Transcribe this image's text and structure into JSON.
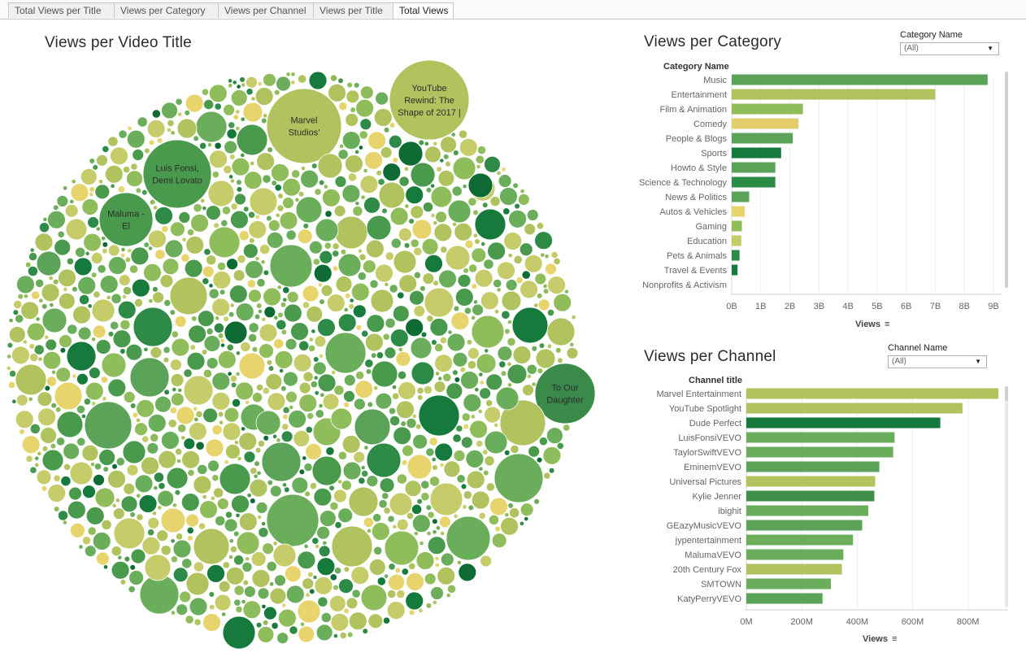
{
  "tabs": [
    {
      "label": "Total Views per Title",
      "active": false
    },
    {
      "label": "Views per Category",
      "active": false
    },
    {
      "label": "Views per Channel",
      "active": false
    },
    {
      "label": "Views per Title",
      "active": false
    },
    {
      "label": "Total Views",
      "active": true
    }
  ],
  "bubble_panel": {
    "title": "Views per Video Title",
    "labeled_bubbles": [
      {
        "label": "YouTube Rewind: The Shape of 2017 |",
        "lines": [
          "YouTube",
          "Rewind: The",
          "Shape of 2017 |"
        ],
        "color": "#b0c35f"
      },
      {
        "label": "Marvel Studios'",
        "lines": [
          "Marvel",
          "Studios'"
        ],
        "color": "#b0c35f"
      },
      {
        "label": "Luis Fonsi, Demi Lovato",
        "lines": [
          "Luis Fonsi,",
          "Demi Lovato"
        ],
        "color": "#4a9a4e"
      },
      {
        "label": "Maluma - El",
        "lines": [
          "Maluma -",
          "El"
        ],
        "color": "#4a9a4e"
      },
      {
        "label": "To Our Daughter",
        "lines": [
          "To Our",
          "Daughter"
        ],
        "color": "#3a8a4a"
      }
    ],
    "palette": [
      "#b0c35f",
      "#c6cc6a",
      "#e8d46c",
      "#8fbd5c",
      "#6aad5a",
      "#4a9a4e",
      "#2e8a47",
      "#157a3c",
      "#0e6b34"
    ]
  },
  "category_panel": {
    "title": "Views per Category",
    "filter": {
      "label": "Category Name",
      "value": "(All)"
    },
    "column_header": "Category Name",
    "axis_title": "Views"
  },
  "channel_panel": {
    "title": "Views per Channel",
    "filter": {
      "label": "Channel Name",
      "value": "(All)"
    },
    "column_header": "Channel title",
    "axis_title": "Views"
  },
  "chart_data": [
    {
      "type": "bar",
      "orientation": "horizontal",
      "title": "Views per Category",
      "ylabel": "Category Name",
      "xlabel": "Views",
      "categories": [
        "Music",
        "Entertainment",
        "Film & Animation",
        "Comedy",
        "People & Blogs",
        "Sports",
        "Howto & Style",
        "Science & Technology",
        "News & Politics",
        "Autos & Vehicles",
        "Gaming",
        "Education",
        "Pets & Animals",
        "Travel & Events",
        "Nonprofits & Activism"
      ],
      "values": [
        8.8,
        7.0,
        2.45,
        2.3,
        2.1,
        1.7,
        1.5,
        1.5,
        0.6,
        0.45,
        0.35,
        0.33,
        0.27,
        0.2,
        0.0
      ],
      "value_unit": "B",
      "colors": [
        "#5ba359",
        "#b0c35f",
        "#8fbd5c",
        "#e3cd6a",
        "#5ba359",
        "#157a3c",
        "#5ba359",
        "#2e8a47",
        "#5ba359",
        "#e8d46c",
        "#8fbd5c",
        "#c6cc6a",
        "#2e8a47",
        "#157a3c",
        "#5ba359"
      ],
      "xticks": [
        "0B",
        "1B",
        "2B",
        "3B",
        "4B",
        "5B",
        "6B",
        "7B",
        "8B",
        "9B"
      ],
      "xlim": [
        0,
        9
      ],
      "grid": true
    },
    {
      "type": "bar",
      "orientation": "horizontal",
      "title": "Views per Channel",
      "ylabel": "Channel title",
      "xlabel": "Views",
      "categories": [
        "Marvel Entertainment",
        "YouTube Spotlight",
        "Dude Perfect",
        "LuisFonsiVEVO",
        "TaylorSwiftVEVO",
        "EminemVEVO",
        "Universal Pictures",
        "Kylie Jenner",
        "ibighit",
        "GEazyMusicVEVO",
        "jypentertainment",
        "MalumaVEVO",
        "20th Century Fox",
        "SMTOWN",
        "KatyPerryVEVO"
      ],
      "values": [
        910,
        780,
        700,
        535,
        530,
        480,
        465,
        462,
        440,
        418,
        385,
        350,
        345,
        305,
        275
      ],
      "value_unit": "M",
      "colors": [
        "#b0c35f",
        "#b0c35f",
        "#157a3c",
        "#6aad5a",
        "#6aad5a",
        "#5ba359",
        "#b0c35f",
        "#3f8f4a",
        "#6aad5a",
        "#5ba359",
        "#6aad5a",
        "#6aad5a",
        "#b0c35f",
        "#6aad5a",
        "#5ba359"
      ],
      "xticks": [
        "0M",
        "200M",
        "400M",
        "600M",
        "800M"
      ],
      "xlim": [
        0,
        930
      ],
      "grid": true
    }
  ]
}
